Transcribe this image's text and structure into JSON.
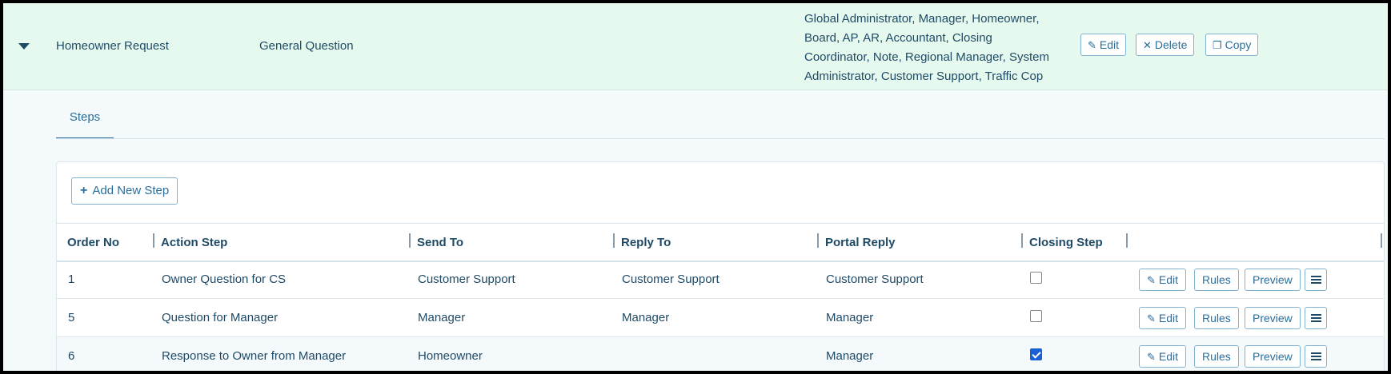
{
  "request": {
    "type": "Homeowner Request",
    "subject": "General Question",
    "roles": "Global Administrator, Manager, Homeowner, Board, AP, AR, Accountant, Closing Coordinator, Note, Regional Manager, System Administrator, Customer Support, Traffic Cop",
    "actions": {
      "edit": "Edit",
      "delete": "Delete",
      "copy": "Copy"
    }
  },
  "tabs": {
    "steps": "Steps"
  },
  "steps_panel": {
    "add_label": "Add New Step",
    "columns": [
      "Order No",
      "Action Step",
      "Send To",
      "Reply To",
      "Portal Reply",
      "Closing Step"
    ],
    "row_actions": {
      "edit": "Edit",
      "rules": "Rules",
      "preview": "Preview"
    },
    "rows": [
      {
        "order": "1",
        "action": "Owner Question for CS",
        "send_to": "Customer Support",
        "reply_to": "Customer Support",
        "portal_reply": "Customer Support",
        "closing": false
      },
      {
        "order": "5",
        "action": "Question for Manager",
        "send_to": "Manager",
        "reply_to": "Manager",
        "portal_reply": "Manager",
        "closing": false
      },
      {
        "order": "6",
        "action": "Response to Owner from Manager",
        "send_to": "Homeowner",
        "reply_to": "",
        "portal_reply": "Manager",
        "closing": true
      }
    ]
  },
  "icons": {
    "expand": "caret-down-icon",
    "edit": "pencil-icon",
    "delete": "x-icon",
    "copy": "copy-icon",
    "add": "plus-icon",
    "menu": "hamburger-icon"
  },
  "colors": {
    "header_bg": "#e6f9ee",
    "accent": "#2a6f9b",
    "checkbox_on": "#1a5fd6"
  }
}
